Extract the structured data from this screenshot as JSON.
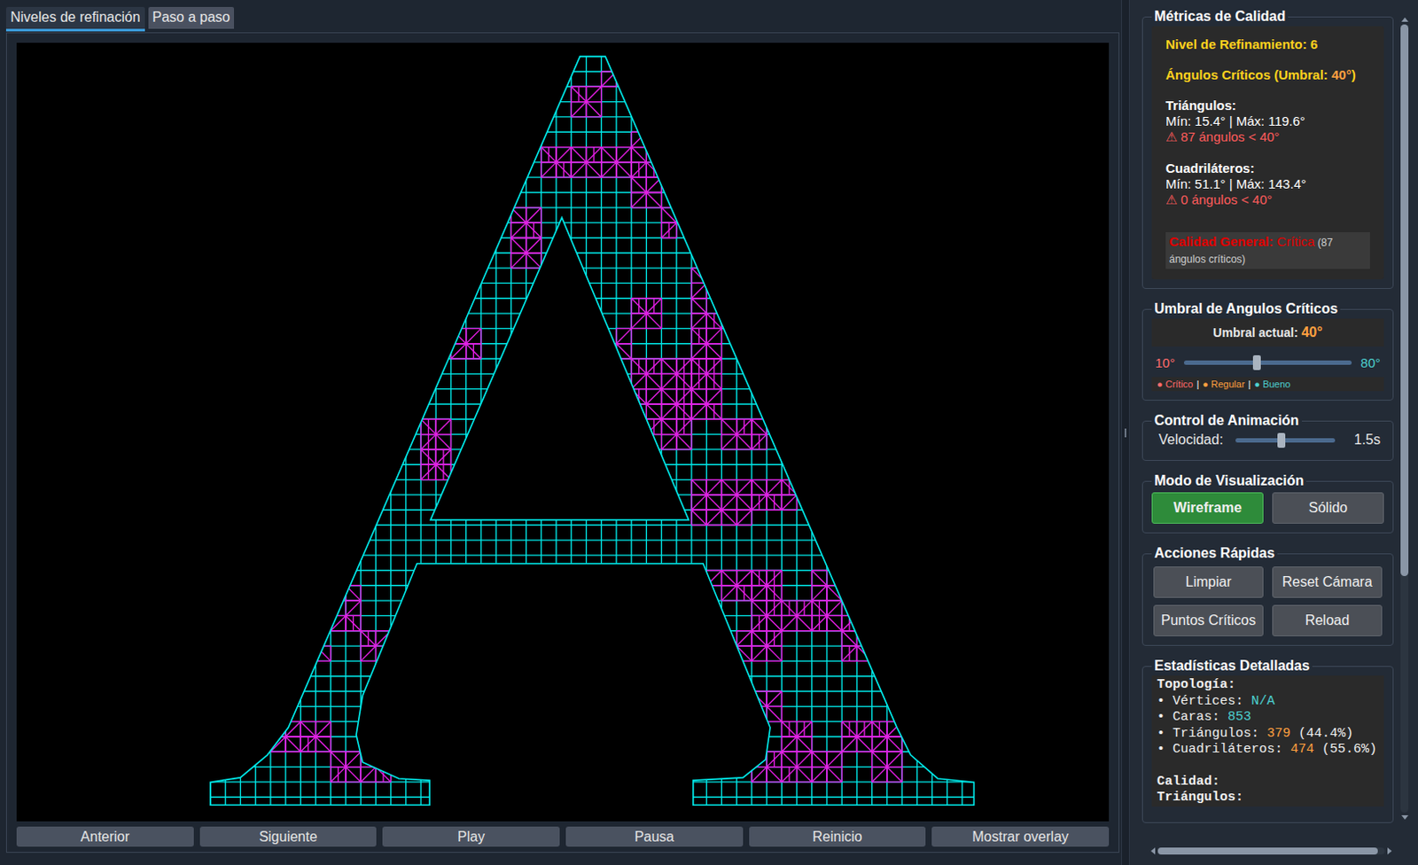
{
  "tabs": [
    {
      "label": "Niveles de refinación",
      "selected": true
    },
    {
      "label": "Paso a paso",
      "selected": false
    }
  ],
  "controls": [
    "Anterior",
    "Siguiente",
    "Play",
    "Pausa",
    "Reinicio",
    "Mostrar overlay"
  ],
  "metrics": {
    "title": "Métricas de Calidad",
    "level": "Nivel de Refinamiento: 6",
    "critical_heading": {
      "prefix": "Ángulos Críticos (Umbral: ",
      "value": "40°",
      "suffix": ")"
    },
    "groups": [
      {
        "title": "Triángulos:",
        "range": "Mín: 15.4° | Máx: 119.6°",
        "warning": "⚠ 87 ángulos < 40°"
      },
      {
        "title": "Cuadriláteros:",
        "range": "Mín: 51.1° | Máx: 143.4°",
        "warning": "⚠ 0 ángulos < 40°"
      }
    ],
    "overall": {
      "label": "Calidad General:",
      "value": "Crítica",
      "note": "(87 ángulos críticos)"
    }
  },
  "threshold": {
    "title": "Umbral de Angulos Críticos",
    "current_label": "Umbral actual: ",
    "current_value": "40°",
    "min": "10°",
    "max": "80°",
    "level": 0.43,
    "bullet": "●",
    "separator": "|",
    "legend": [
      {
        "label": "Crítico",
        "color": "#ff6b6b"
      },
      {
        "label": "Regular",
        "color": "#ffa040"
      },
      {
        "label": "Bueno",
        "color": "#4dd0d0"
      }
    ]
  },
  "animation": {
    "title": "Control de Animación",
    "label": "Velocidad:",
    "level": 0.46,
    "reading": "1.5s"
  },
  "view_mode": {
    "title": "Modo de Visualización",
    "options": [
      {
        "label": "Wireframe",
        "selected": true
      },
      {
        "label": "Sólido",
        "selected": false
      }
    ]
  },
  "actions": {
    "title": "Acciones Rápidas",
    "buttons": [
      "Limpiar",
      "Reset Cámara",
      "Puntos Críticos",
      "Reload"
    ]
  },
  "stats": {
    "title": "Estadísticas Detalladas",
    "sections": [
      {
        "title": "Topología:",
        "items": [
          {
            "label": "• Vértices: ",
            "value": "N/A",
            "extra": "",
            "color": "#4dd0d0"
          },
          {
            "label": "• Caras: ",
            "value": "853",
            "extra": "",
            "color": "#4dd0d0"
          },
          {
            "label": "• Triángulos: ",
            "value": "379",
            "extra": " (44.4%)",
            "color": "#ffa040"
          },
          {
            "label": "• Cuadriláteros: ",
            "value": "474",
            "extra": " (55.6%)",
            "color": "#ffa040"
          }
        ]
      },
      {
        "title": "Calidad:",
        "subtitle": "Triángulos:",
        "items": []
      }
    ]
  }
}
